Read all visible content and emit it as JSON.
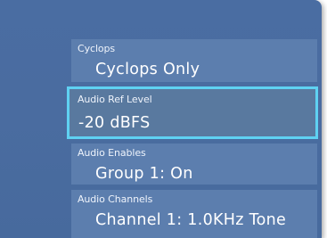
{
  "settings": [
    {
      "label": "Cyclops",
      "value": "Cyclops Only",
      "selected": false
    },
    {
      "label": "Audio Ref Level",
      "value": "-20 dBFS",
      "selected": true
    },
    {
      "label": "Audio Enables",
      "value": "Group 1: On",
      "selected": false
    },
    {
      "label": "Audio Channels",
      "value": "Channel 1: 1.0KHz Tone",
      "selected": false
    }
  ],
  "colors": {
    "panel_bg": "#4a6ca0",
    "row_bg": "#5c7eae",
    "selection_border": "#5fd1f2",
    "text": "#ffffff"
  }
}
